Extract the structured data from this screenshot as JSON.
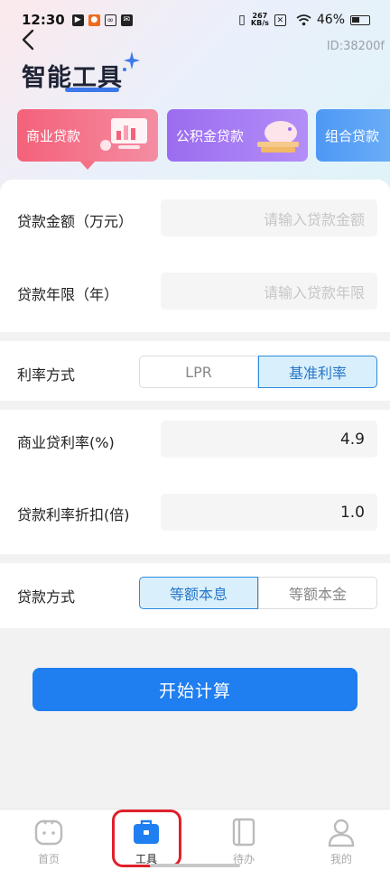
{
  "status_bar": {
    "time": "12:30",
    "net_speed_value": "267",
    "net_speed_unit": "KB/s",
    "battery": "46%"
  },
  "header": {
    "id_text": "ID:38200f",
    "brand_title": "智能工具"
  },
  "loan_types": [
    {
      "label": "商业贷款",
      "selected": true
    },
    {
      "label": "公积金贷款",
      "selected": false
    },
    {
      "label": "组合贷款",
      "selected": false
    }
  ],
  "form": {
    "amount": {
      "label": "贷款金额（万元）",
      "placeholder": "请输入贷款金额"
    },
    "years": {
      "label": "贷款年限（年）",
      "placeholder": "请输入贷款年限"
    },
    "rate_mode": {
      "label": "利率方式",
      "options": [
        "LPR",
        "基准利率"
      ],
      "selected": "基准利率"
    },
    "commercial_rate": {
      "label": "商业贷利率(%)",
      "value": "4.9"
    },
    "discount": {
      "label": "贷款利率折扣(倍)",
      "value": "1.0"
    },
    "repay_mode": {
      "label": "贷款方式",
      "options": [
        "等额本息",
        "等额本金"
      ],
      "selected": "等额本息"
    }
  },
  "calculate_button": "开始计算",
  "tabs": [
    {
      "label": "首页",
      "icon": "home-face-icon"
    },
    {
      "label": "工具",
      "icon": "toolbox-icon",
      "active": true
    },
    {
      "label": "待办",
      "icon": "notebook-icon"
    },
    {
      "label": "我的",
      "icon": "user-icon"
    }
  ],
  "colors": {
    "primary": "#1f7ef0",
    "card_commercial": "#f4617a",
    "card_fund": "#9b6cf0",
    "card_combo": "#4e97f5",
    "highlight": "#e0202a"
  }
}
